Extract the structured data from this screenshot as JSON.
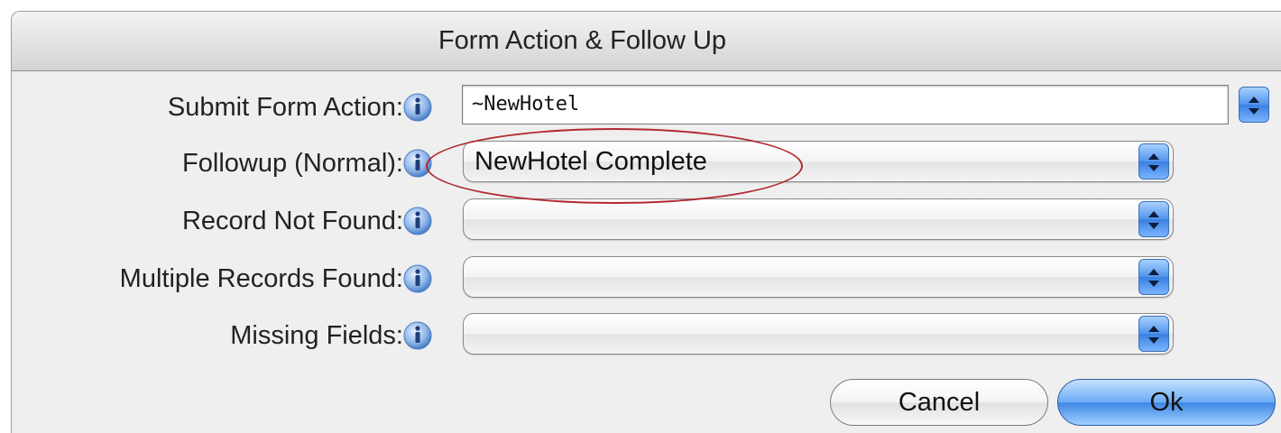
{
  "dialog": {
    "title": "Form Action & Follow Up"
  },
  "fields": {
    "submit_action": {
      "label": "Submit Form Action:",
      "value": "~NewHotel"
    },
    "followup_normal": {
      "label": "Followup (Normal):",
      "value": "NewHotel Complete"
    },
    "record_not_found": {
      "label": "Record Not Found:",
      "value": ""
    },
    "multiple_records": {
      "label": "Multiple Records Found:",
      "value": ""
    },
    "missing_fields": {
      "label": "Missing Fields:",
      "value": ""
    }
  },
  "buttons": {
    "cancel": "Cancel",
    "ok": "Ok"
  },
  "icons": {
    "info": "info-icon",
    "stepper": "up-down-arrows-icon"
  },
  "colors": {
    "highlight": "#b22a32",
    "accent": "#4f93ec"
  }
}
